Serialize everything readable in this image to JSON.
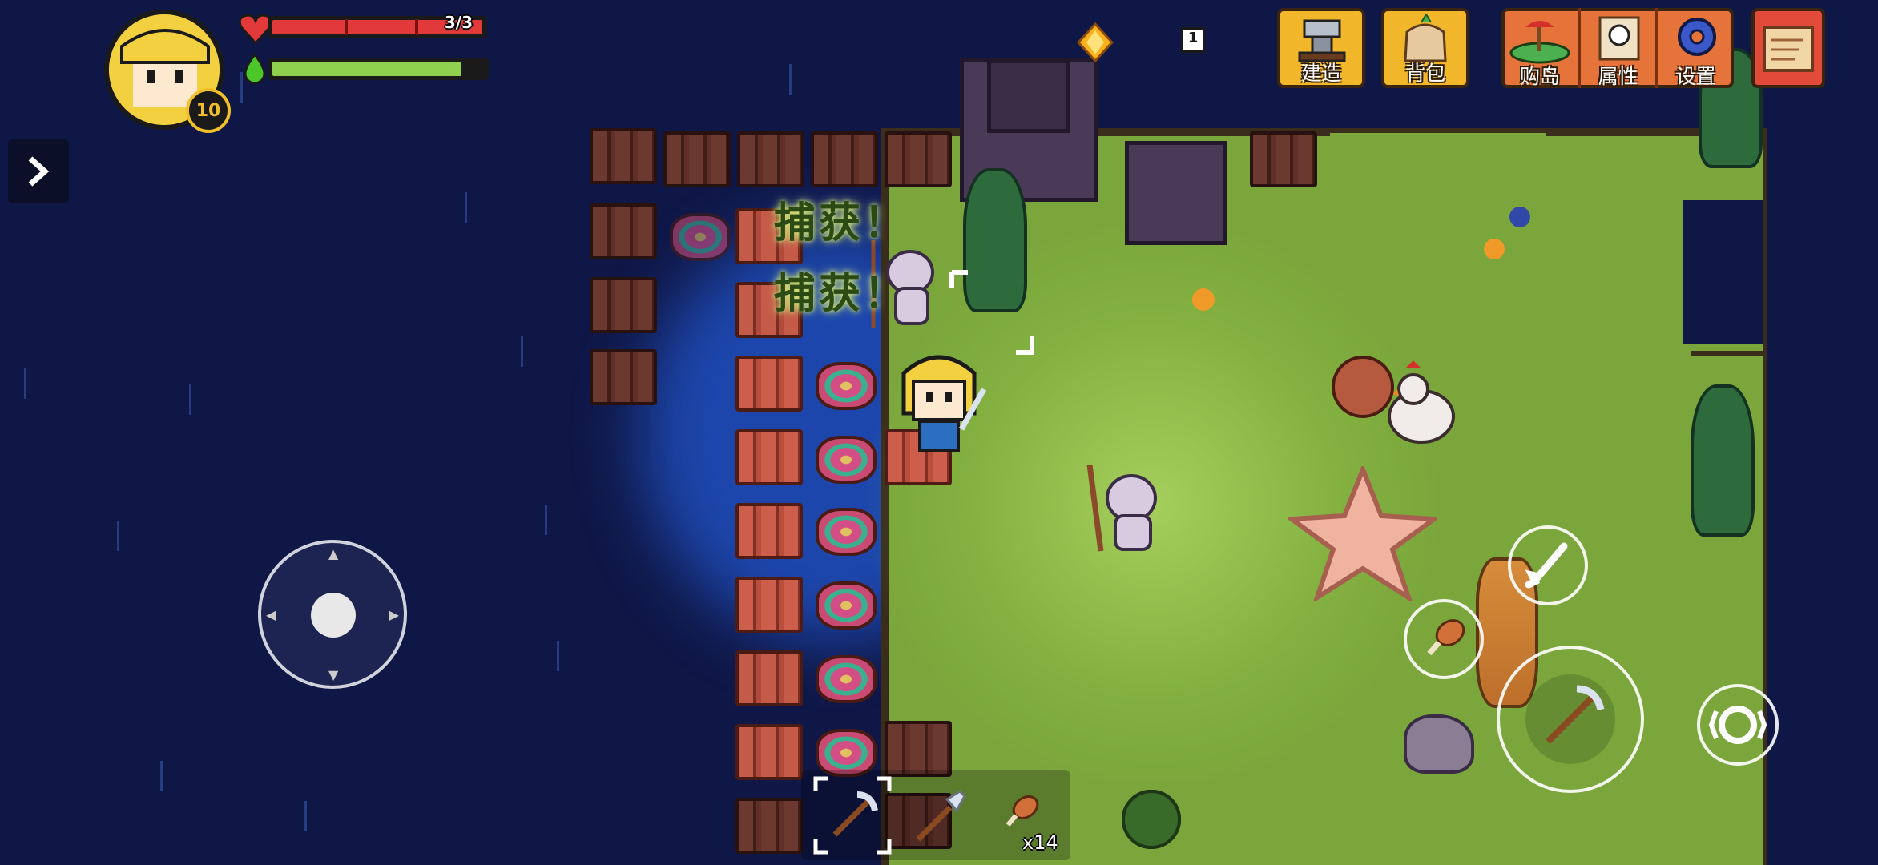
{
  "hud": {
    "health_text": "3/3",
    "health_value": 3,
    "health_max": 3,
    "energy_fraction": 0.9,
    "player_level": "10",
    "currency_count": "1"
  },
  "menu": {
    "build_label": "建造",
    "bag_label": "背包",
    "buy_island_label": "购岛",
    "attributes_label": "属性",
    "settings_label": "设置"
  },
  "world": {
    "capture_text_1": "捕获！",
    "capture_text_2": "捕获！"
  },
  "hotbar": {
    "items": [
      {
        "icon": "pickaxe-icon",
        "selected": true
      },
      {
        "icon": "shovel-icon",
        "selected": false
      },
      {
        "icon": "chicken-leg-icon",
        "count": "x14",
        "selected": false
      }
    ]
  },
  "colors": {
    "night_sky": "#0f1747",
    "grass": "#7aa63b",
    "health_red": "#e23a3a",
    "energy_green": "#8fd14f",
    "menu_gold": "#f2b62a",
    "menu_orange": "#e6733a"
  }
}
